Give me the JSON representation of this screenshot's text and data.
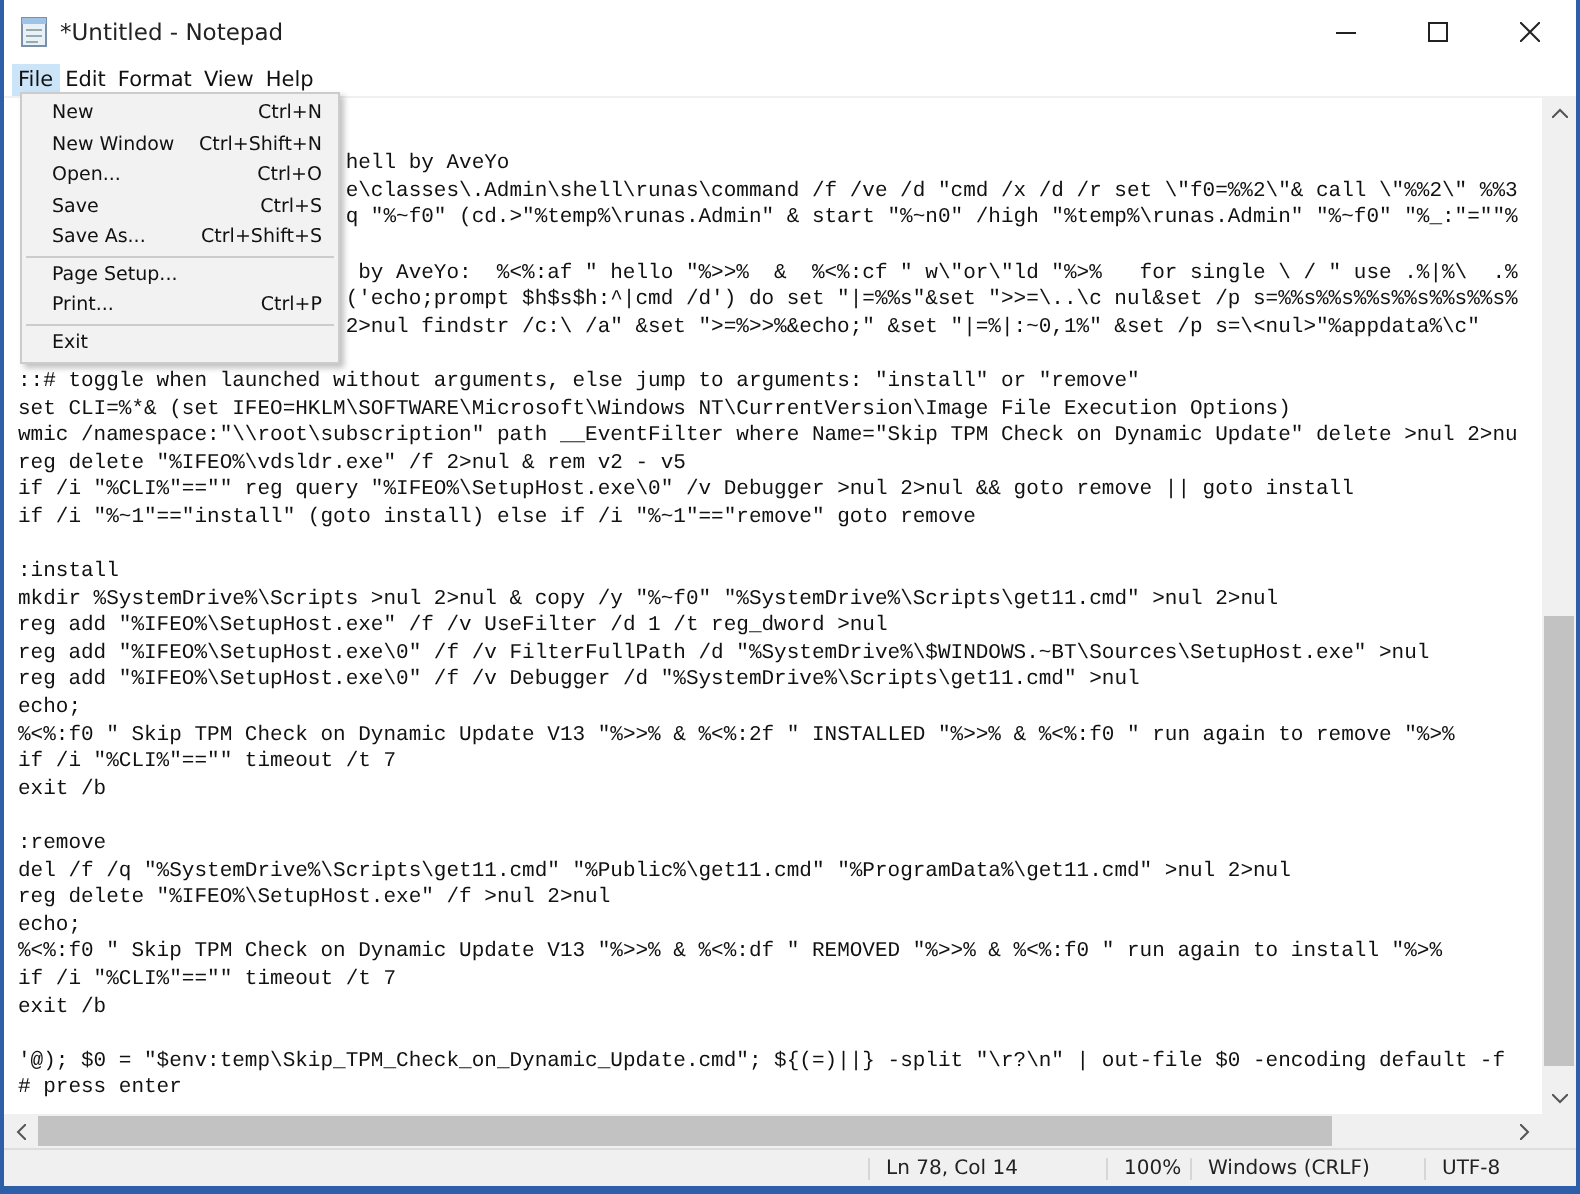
{
  "window": {
    "title": "*Untitled - Notepad"
  },
  "menu_bar": [
    {
      "label": "File",
      "selected": true
    },
    {
      "label": "Edit",
      "selected": false
    },
    {
      "label": "Format",
      "selected": false
    },
    {
      "label": "View",
      "selected": false
    },
    {
      "label": "Help",
      "selected": false
    }
  ],
  "file_menu": [
    {
      "kind": "item",
      "label": "New",
      "shortcut": "Ctrl+N"
    },
    {
      "kind": "item",
      "label": "New Window",
      "shortcut": "Ctrl+Shift+N"
    },
    {
      "kind": "item",
      "label": "Open...",
      "shortcut": "Ctrl+O"
    },
    {
      "kind": "item",
      "label": "Save",
      "shortcut": "Ctrl+S"
    },
    {
      "kind": "item",
      "label": "Save As...",
      "shortcut": "Ctrl+Shift+S"
    },
    {
      "kind": "separator"
    },
    {
      "kind": "item",
      "label": "Page Setup..."
    },
    {
      "kind": "item",
      "label": "Print...",
      "shortcut": "Ctrl+P"
    },
    {
      "kind": "separator"
    },
    {
      "kind": "item",
      "label": "Exit"
    }
  ],
  "editor_lines": [
    {
      "kind": "blank"
    },
    {
      "kind": "blank"
    },
    {
      "kind": "covered",
      "text": "hell by AveYo"
    },
    {
      "kind": "covered",
      "text": "e\\classes\\.Admin\\shell\\runas\\command /f /ve /d \"cmd /x /d /r set \\\"f0=%%2\\\"& call \\\"%%2\\\" %%3"
    },
    {
      "kind": "covered",
      "text": "q \"%~f0\" (cd.>\"%temp%\\runas.Admin\" & start \"%~n0\" /high \"%temp%\\runas.Admin\" \"%~f0\" \"%_:\"=\"\"%"
    },
    {
      "kind": "blank"
    },
    {
      "kind": "covered",
      "text": " by AveYo:  %<%:af \" hello \"%>>%  &  %<%:cf \" w\\\"or\\\"ld \"%>%   for single \\ / \" use .%|%\\  .%"
    },
    {
      "kind": "covered",
      "text": "('echo;prompt $h$s$h:^|cmd /d') do set \"|=%%s\"&set \">>=\\..\\c nul&set /p s=%%s%%s%%s%%s%%s%%s%"
    },
    {
      "kind": "covered",
      "text": "2>nul findstr /c:\\ /a\" &set \">=%>>%&echo;\" &set \"|=%|:~0,1%\" &set /p s=\\<nul>\"%appdata%\\c\""
    },
    {
      "kind": "blank"
    },
    {
      "kind": "text",
      "text": "::# toggle when launched without arguments, else jump to arguments: \"install\" or \"remove\""
    },
    {
      "kind": "text",
      "text": "set CLI=%*& (set IFEO=HKLM\\SOFTWARE\\Microsoft\\Windows NT\\CurrentVersion\\Image File Execution Options)"
    },
    {
      "kind": "text",
      "text": "wmic /namespace:\"\\\\root\\subscription\" path __EventFilter where Name=\"Skip TPM Check on Dynamic Update\" delete >nul 2>nu"
    },
    {
      "kind": "text",
      "text": "reg delete \"%IFEO%\\vdsldr.exe\" /f 2>nul & rem v2 - v5"
    },
    {
      "kind": "text",
      "text": "if /i \"%CLI%\"==\"\" reg query \"%IFEO%\\SetupHost.exe\\0\" /v Debugger >nul 2>nul && goto remove || goto install"
    },
    {
      "kind": "text",
      "text": "if /i \"%~1\"==\"install\" (goto install) else if /i \"%~1\"==\"remove\" goto remove"
    },
    {
      "kind": "blank"
    },
    {
      "kind": "text",
      "text": ":install"
    },
    {
      "kind": "text",
      "text": "mkdir %SystemDrive%\\Scripts >nul 2>nul & copy /y \"%~f0\" \"%SystemDrive%\\Scripts\\get11.cmd\" >nul 2>nul"
    },
    {
      "kind": "text",
      "text": "reg add \"%IFEO%\\SetupHost.exe\" /f /v UseFilter /d 1 /t reg_dword >nul"
    },
    {
      "kind": "text",
      "text": "reg add \"%IFEO%\\SetupHost.exe\\0\" /f /v FilterFullPath /d \"%SystemDrive%\\$WINDOWS.~BT\\Sources\\SetupHost.exe\" >nul"
    },
    {
      "kind": "text",
      "text": "reg add \"%IFEO%\\SetupHost.exe\\0\" /f /v Debugger /d \"%SystemDrive%\\Scripts\\get11.cmd\" >nul"
    },
    {
      "kind": "text",
      "text": "echo;"
    },
    {
      "kind": "text",
      "text": "%<%:f0 \" Skip TPM Check on Dynamic Update V13 \"%>>% & %<%:2f \" INSTALLED \"%>>% & %<%:f0 \" run again to remove \"%>%"
    },
    {
      "kind": "text",
      "text": "if /i \"%CLI%\"==\"\" timeout /t 7"
    },
    {
      "kind": "text",
      "text": "exit /b"
    },
    {
      "kind": "blank"
    },
    {
      "kind": "text",
      "text": ":remove"
    },
    {
      "kind": "text",
      "text": "del /f /q \"%SystemDrive%\\Scripts\\get11.cmd\" \"%Public%\\get11.cmd\" \"%ProgramData%\\get11.cmd\" >nul 2>nul"
    },
    {
      "kind": "text",
      "text": "reg delete \"%IFEO%\\SetupHost.exe\" /f >nul 2>nul"
    },
    {
      "kind": "text",
      "text": "echo;"
    },
    {
      "kind": "text",
      "text": "%<%:f0 \" Skip TPM Check on Dynamic Update V13 \"%>>% & %<%:df \" REMOVED \"%>>% & %<%:f0 \" run again to install \"%>%"
    },
    {
      "kind": "text",
      "text": "if /i \"%CLI%\"==\"\" timeout /t 7"
    },
    {
      "kind": "text",
      "text": "exit /b"
    },
    {
      "kind": "blank"
    },
    {
      "kind": "text",
      "text": "'@); $0 = \"$env:temp\\Skip_TPM_Check_on_Dynamic_Update.cmd\"; ${(=)||} -split \"\\r?\\n\" | out-file $0 -encoding default -f"
    },
    {
      "kind": "text",
      "text": "# press enter"
    }
  ],
  "status_bar": {
    "position": "Ln 78, Col 14",
    "zoom": "100%",
    "line_ending": "Windows (CRLF)",
    "encoding": "UTF-8"
  }
}
